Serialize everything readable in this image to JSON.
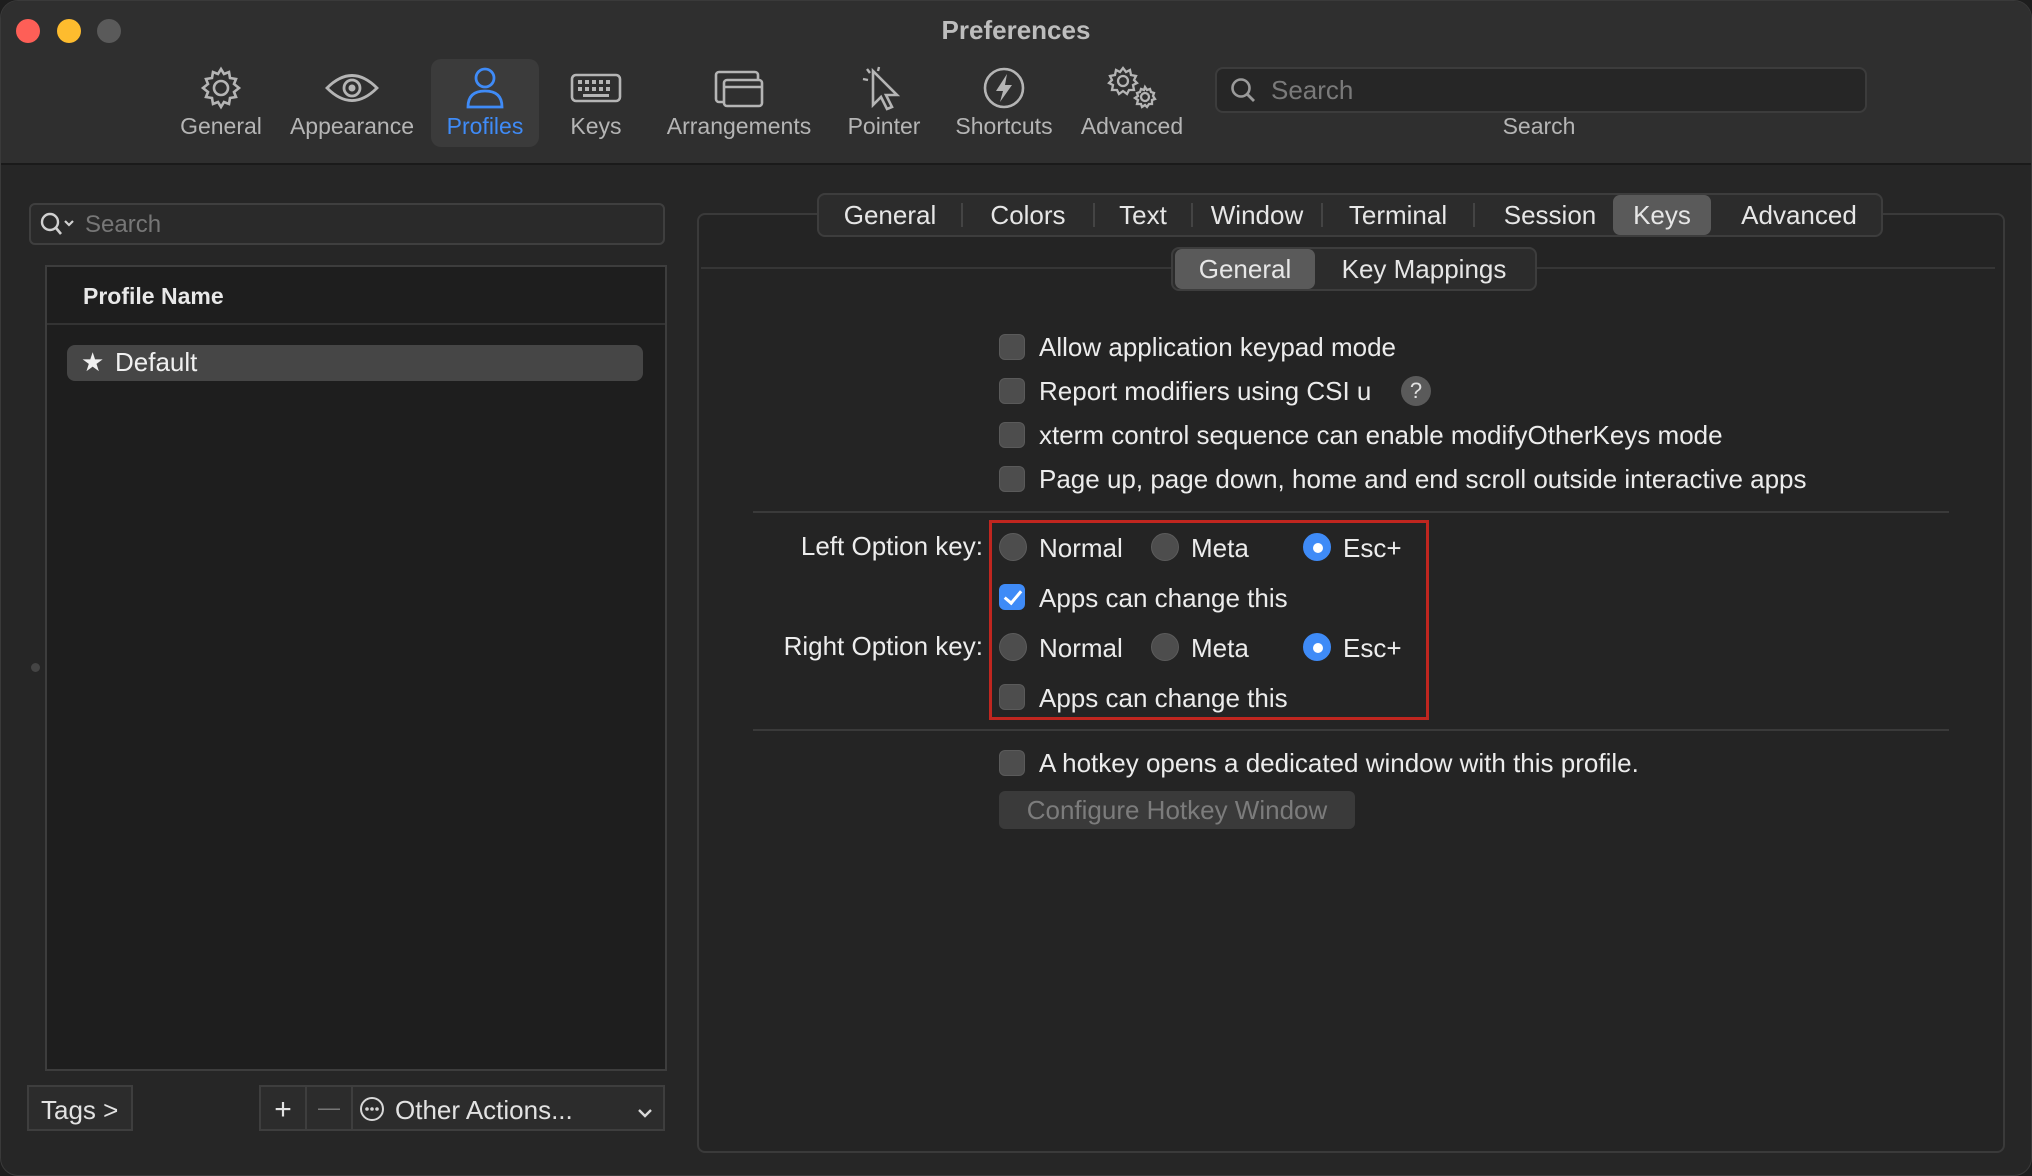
{
  "window": {
    "title": "Preferences"
  },
  "toolbar": {
    "items": [
      {
        "label": "General",
        "icon": "gear-icon"
      },
      {
        "label": "Appearance",
        "icon": "eye-icon"
      },
      {
        "label": "Profiles",
        "icon": "person-icon"
      },
      {
        "label": "Keys",
        "icon": "keyboard-icon"
      },
      {
        "label": "Arrangements",
        "icon": "windows-icon"
      },
      {
        "label": "Pointer",
        "icon": "pointer-icon"
      },
      {
        "label": "Shortcuts",
        "icon": "lightning-icon"
      },
      {
        "label": "Advanced",
        "icon": "gears-icon"
      }
    ],
    "active": "Profiles",
    "search_placeholder": "Search",
    "search_label": "Search"
  },
  "profiles": {
    "search_placeholder": "Search",
    "column_header": "Profile Name",
    "rows": [
      {
        "name": "Default",
        "is_default": true
      }
    ],
    "tags_button": "Tags >",
    "add_button": "+",
    "remove_button": "—",
    "other_actions": "Other Actions..."
  },
  "tabs": {
    "items": [
      "General",
      "Colors",
      "Text",
      "Window",
      "Terminal",
      "Session",
      "Keys",
      "Advanced"
    ],
    "active": "Keys"
  },
  "subtabs": {
    "items": [
      "General",
      "Key Mappings"
    ],
    "active": "General"
  },
  "keys": {
    "options": [
      {
        "label": "Allow application keypad mode",
        "checked": false
      },
      {
        "label": "Report modifiers using CSI u",
        "checked": false
      },
      {
        "label": "xterm control sequence can enable modifyOtherKeys mode",
        "checked": false
      },
      {
        "label": "Page up, page down, home and end scroll outside interactive apps",
        "checked": false
      }
    ],
    "help_glyph": "?",
    "left_option": {
      "label": "Left Option key:",
      "choices": [
        "Normal",
        "Meta",
        "Esc+"
      ],
      "selected": "Esc+",
      "apps_can_change": {
        "label": "Apps can change this",
        "checked": true
      }
    },
    "right_option": {
      "label": "Right Option key:",
      "choices": [
        "Normal",
        "Meta",
        "Esc+"
      ],
      "selected": "Esc+",
      "apps_can_change": {
        "label": "Apps can change this",
        "checked": false
      }
    },
    "hotkey": {
      "label": "A hotkey opens a dedicated window with this profile.",
      "checked": false
    },
    "configure_hotkey_button": "Configure Hotkey Window"
  },
  "colors": {
    "accent": "#3f8bf7",
    "highlight_box": "#c0261f",
    "close": "#fe5f57",
    "minimize": "#febc2e"
  }
}
